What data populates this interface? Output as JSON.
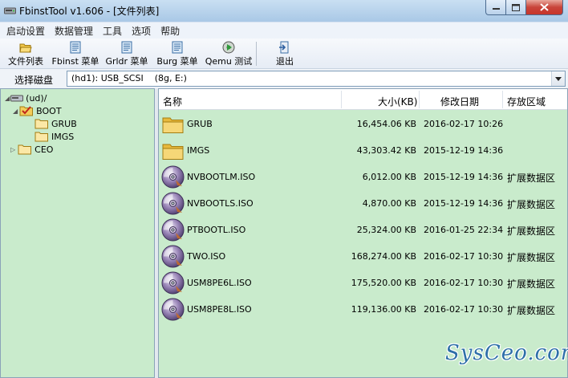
{
  "window": {
    "title": "FbinstTool v1.606 - [文件列表]"
  },
  "menu": [
    "启动设置",
    "数据管理",
    "工具",
    "选项",
    "帮助"
  ],
  "toolbar": [
    {
      "label": "文件列表",
      "icon": "folder-open-icon"
    },
    {
      "label": "Fbinst 菜单",
      "icon": "document-icon"
    },
    {
      "label": "Grldr 菜单",
      "icon": "document-icon"
    },
    {
      "label": "Burg 菜单",
      "icon": "document-icon"
    },
    {
      "label": "Qemu 测试",
      "icon": "cd-play-icon"
    },
    {
      "label": "退出",
      "icon": "exit-icon"
    }
  ],
  "disk": {
    "label": "选择磁盘",
    "value": "(hd1): USB_SCSI    (8g, E:)"
  },
  "tree": [
    {
      "label": "(ud)/",
      "icon": "drive-icon",
      "expander": "◢"
    },
    {
      "label": "BOOT",
      "icon": "folder-checked-icon",
      "expander": "◢"
    },
    {
      "label": "GRUB",
      "icon": "folder-icon",
      "expander": ""
    },
    {
      "label": "IMGS",
      "icon": "folder-icon",
      "expander": ""
    },
    {
      "label": "CEO",
      "icon": "folder-icon",
      "expander": "▷"
    }
  ],
  "columns": {
    "name": "名称",
    "size": "大小(KB)",
    "date": "修改日期",
    "zone": "存放区域"
  },
  "files": [
    {
      "name": "GRUB",
      "type": "folder",
      "size": "16,454.06 KB",
      "date": "2016-02-17 10:26",
      "zone": ""
    },
    {
      "name": "IMGS",
      "type": "folder",
      "size": "43,303.42 KB",
      "date": "2015-12-19 14:36",
      "zone": ""
    },
    {
      "name": "NVBOOTLM.ISO",
      "type": "iso",
      "size": "6,012.00 KB",
      "date": "2015-12-19 14:36",
      "zone": "扩展数据区"
    },
    {
      "name": "NVBOOTLS.ISO",
      "type": "iso",
      "size": "4,870.00 KB",
      "date": "2015-12-19 14:36",
      "zone": "扩展数据区"
    },
    {
      "name": "PTBOOTL.ISO",
      "type": "iso",
      "size": "25,324.00 KB",
      "date": "2016-01-25 22:34",
      "zone": "扩展数据区"
    },
    {
      "name": "TWO.ISO",
      "type": "iso",
      "size": "168,274.00 KB",
      "date": "2016-02-17 10:30",
      "zone": "扩展数据区"
    },
    {
      "name": "USM8PE6L.ISO",
      "type": "iso",
      "size": "175,520.00 KB",
      "date": "2016-02-17 10:30",
      "zone": "扩展数据区"
    },
    {
      "name": "USM8PE8L.ISO",
      "type": "iso",
      "size": "119,136.00 KB",
      "date": "2016-02-17 10:30",
      "zone": "扩展数据区"
    }
  ],
  "watermark": "SysCeo.com",
  "colors": {
    "pane_background": "#c9ebcc",
    "titlebar": "#a9c8e6",
    "close_button": "#c7362b"
  }
}
